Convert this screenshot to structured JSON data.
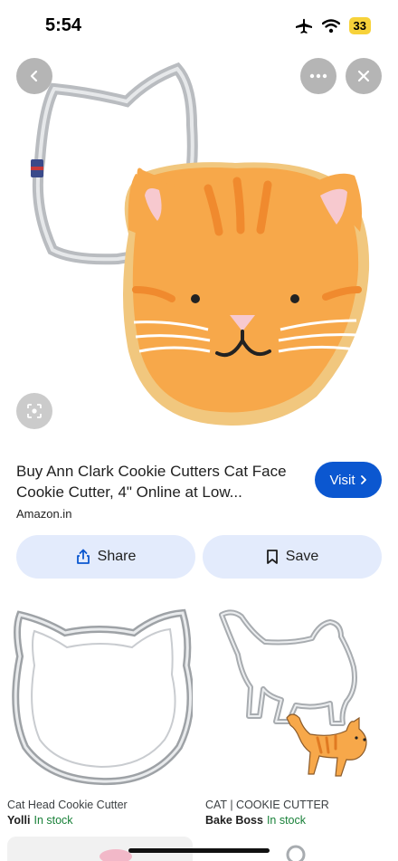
{
  "status_bar": {
    "time": "5:54",
    "battery": "33"
  },
  "viewer": {
    "back_icon": "chevron-left-icon",
    "more_icon": "more-horizontal-icon",
    "close_icon": "close-icon",
    "lens_icon": "lens-search-icon"
  },
  "result": {
    "title": "Buy Ann Clark Cookie Cutters Cat Face Cookie Cutter, 4\" Online at Low...",
    "source": "Amazon.in",
    "visit_label": "Visit"
  },
  "actions": {
    "share_label": "Share",
    "save_label": "Save"
  },
  "related": [
    {
      "title": "Cat Head Cookie Cutter",
      "store": "Yolli",
      "stock": "In stock"
    },
    {
      "title": "CAT | COOKIE CUTTER",
      "store": "Bake Boss",
      "stock": "In stock"
    }
  ],
  "colors": {
    "accent": "#0b57d0",
    "action_bg": "#e3ebfc",
    "stock_green": "#188038",
    "cookie_orange": "#f7a84a"
  }
}
